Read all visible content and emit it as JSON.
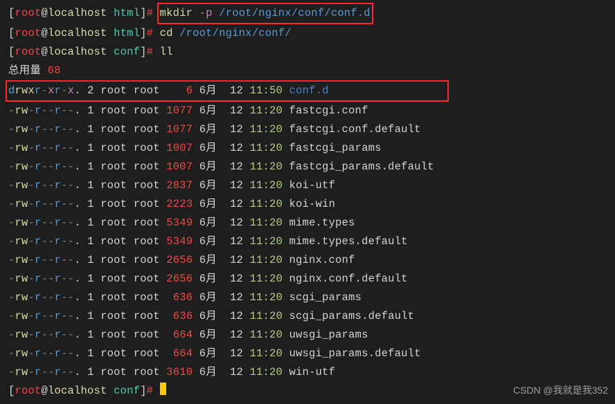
{
  "prompts": [
    {
      "user": "root",
      "host": "localhost",
      "cwd": "html",
      "cmd": {
        "base": "mkdir",
        "flag": "-p",
        "path": "/root/nginx/conf/conf.d"
      },
      "highlight": true
    },
    {
      "user": "root",
      "host": "localhost",
      "cwd": "html",
      "cmd": {
        "base": "cd",
        "flag": "",
        "path": "/root/nginx/conf/"
      },
      "highlight": false
    },
    {
      "user": "root",
      "host": "localhost",
      "cwd": "conf",
      "cmd": {
        "base": "ll",
        "flag": "",
        "path": ""
      },
      "highlight": false
    }
  ],
  "totalLabel": "总用量",
  "totalValue": "68",
  "listing": [
    {
      "perm": {
        "type": "d",
        "u": "rwx",
        "g": "r-x",
        "o": "r-x",
        "dot": "."
      },
      "links": "2",
      "owner": "root",
      "group": "root",
      "size": "   6",
      "month": "6月",
      "day": "12",
      "time": "11:50",
      "name": "conf.d",
      "nameClass": "c-blue-dir",
      "highlight": true
    },
    {
      "perm": {
        "type": "-",
        "u": "rw-",
        "g": "r--",
        "o": "r--",
        "dot": "."
      },
      "links": "1",
      "owner": "root",
      "group": "root",
      "size": "1077",
      "month": "6月",
      "day": "12",
      "time": "11:20",
      "name": "fastcgi.conf",
      "nameClass": "c-white",
      "highlight": false
    },
    {
      "perm": {
        "type": "-",
        "u": "rw-",
        "g": "r--",
        "o": "r--",
        "dot": "."
      },
      "links": "1",
      "owner": "root",
      "group": "root",
      "size": "1077",
      "month": "6月",
      "day": "12",
      "time": "11:20",
      "name": "fastcgi.conf.default",
      "nameClass": "c-white",
      "highlight": false
    },
    {
      "perm": {
        "type": "-",
        "u": "rw-",
        "g": "r--",
        "o": "r--",
        "dot": "."
      },
      "links": "1",
      "owner": "root",
      "group": "root",
      "size": "1007",
      "month": "6月",
      "day": "12",
      "time": "11:20",
      "name": "fastcgi_params",
      "nameClass": "c-white",
      "highlight": false
    },
    {
      "perm": {
        "type": "-",
        "u": "rw-",
        "g": "r--",
        "o": "r--",
        "dot": "."
      },
      "links": "1",
      "owner": "root",
      "group": "root",
      "size": "1007",
      "month": "6月",
      "day": "12",
      "time": "11:20",
      "name": "fastcgi_params.default",
      "nameClass": "c-white",
      "highlight": false
    },
    {
      "perm": {
        "type": "-",
        "u": "rw-",
        "g": "r--",
        "o": "r--",
        "dot": "."
      },
      "links": "1",
      "owner": "root",
      "group": "root",
      "size": "2837",
      "month": "6月",
      "day": "12",
      "time": "11:20",
      "name": "koi-utf",
      "nameClass": "c-white",
      "highlight": false
    },
    {
      "perm": {
        "type": "-",
        "u": "rw-",
        "g": "r--",
        "o": "r--",
        "dot": "."
      },
      "links": "1",
      "owner": "root",
      "group": "root",
      "size": "2223",
      "month": "6月",
      "day": "12",
      "time": "11:20",
      "name": "koi-win",
      "nameClass": "c-white",
      "highlight": false
    },
    {
      "perm": {
        "type": "-",
        "u": "rw-",
        "g": "r--",
        "o": "r--",
        "dot": "."
      },
      "links": "1",
      "owner": "root",
      "group": "root",
      "size": "5349",
      "month": "6月",
      "day": "12",
      "time": "11:20",
      "name": "mime.types",
      "nameClass": "c-white",
      "highlight": false
    },
    {
      "perm": {
        "type": "-",
        "u": "rw-",
        "g": "r--",
        "o": "r--",
        "dot": "."
      },
      "links": "1",
      "owner": "root",
      "group": "root",
      "size": "5349",
      "month": "6月",
      "day": "12",
      "time": "11:20",
      "name": "mime.types.default",
      "nameClass": "c-white",
      "highlight": false
    },
    {
      "perm": {
        "type": "-",
        "u": "rw-",
        "g": "r--",
        "o": "r--",
        "dot": "."
      },
      "links": "1",
      "owner": "root",
      "group": "root",
      "size": "2656",
      "month": "6月",
      "day": "12",
      "time": "11:20",
      "name": "nginx.conf",
      "nameClass": "c-white",
      "highlight": false
    },
    {
      "perm": {
        "type": "-",
        "u": "rw-",
        "g": "r--",
        "o": "r--",
        "dot": "."
      },
      "links": "1",
      "owner": "root",
      "group": "root",
      "size": "2656",
      "month": "6月",
      "day": "12",
      "time": "11:20",
      "name": "nginx.conf.default",
      "nameClass": "c-white",
      "highlight": false
    },
    {
      "perm": {
        "type": "-",
        "u": "rw-",
        "g": "r--",
        "o": "r--",
        "dot": "."
      },
      "links": "1",
      "owner": "root",
      "group": "root",
      "size": " 636",
      "month": "6月",
      "day": "12",
      "time": "11:20",
      "name": "scgi_params",
      "nameClass": "c-white",
      "highlight": false
    },
    {
      "perm": {
        "type": "-",
        "u": "rw-",
        "g": "r--",
        "o": "r--",
        "dot": "."
      },
      "links": "1",
      "owner": "root",
      "group": "root",
      "size": " 636",
      "month": "6月",
      "day": "12",
      "time": "11:20",
      "name": "scgi_params.default",
      "nameClass": "c-white",
      "highlight": false
    },
    {
      "perm": {
        "type": "-",
        "u": "rw-",
        "g": "r--",
        "o": "r--",
        "dot": "."
      },
      "links": "1",
      "owner": "root",
      "group": "root",
      "size": " 664",
      "month": "6月",
      "day": "12",
      "time": "11:20",
      "name": "uwsgi_params",
      "nameClass": "c-white",
      "highlight": false
    },
    {
      "perm": {
        "type": "-",
        "u": "rw-",
        "g": "r--",
        "o": "r--",
        "dot": "."
      },
      "links": "1",
      "owner": "root",
      "group": "root",
      "size": " 664",
      "month": "6月",
      "day": "12",
      "time": "11:20",
      "name": "uwsgi_params.default",
      "nameClass": "c-white",
      "highlight": false
    },
    {
      "perm": {
        "type": "-",
        "u": "rw-",
        "g": "r--",
        "o": "r--",
        "dot": "."
      },
      "links": "1",
      "owner": "root",
      "group": "root",
      "size": "3610",
      "month": "6月",
      "day": "12",
      "time": "11:20",
      "name": "win-utf",
      "nameClass": "c-white",
      "highlight": false
    }
  ],
  "finalPrompt": {
    "user": "root",
    "host": "localhost",
    "cwd": "conf"
  },
  "watermark": "CSDN @我就是我352"
}
